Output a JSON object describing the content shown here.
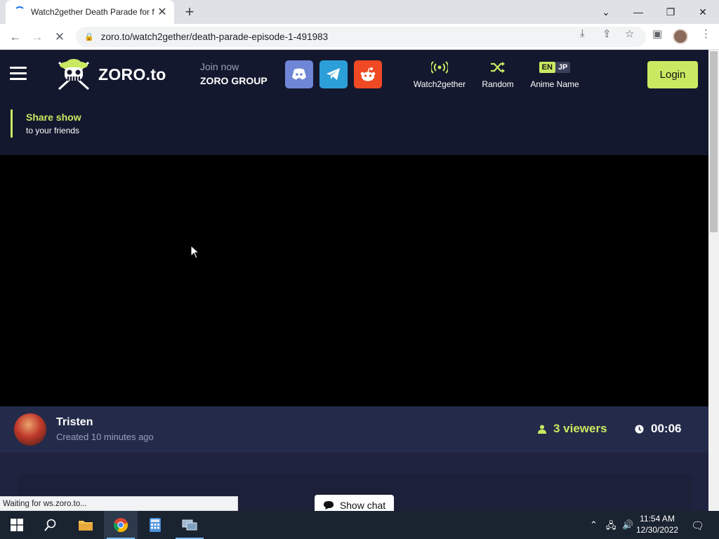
{
  "browser": {
    "tab_title": "Watch2gether Death Parade for f",
    "url": "zoro.to/watch2gether/death-parade-episode-1-491983",
    "status_text": "Waiting for ws.zoro.to..."
  },
  "site": {
    "logo_text": "ZORO.to",
    "join_top": "Join now",
    "join_bottom": "ZORO GROUP",
    "social": [
      "discord-icon",
      "telegram-icon",
      "reddit-icon"
    ],
    "nav": {
      "watch2gether": "Watch2gether",
      "random": "Random",
      "anime_name": "Anime Name",
      "lang_en": "EN",
      "lang_jp": "JP"
    },
    "login_label": "Login",
    "accent": "#cae962"
  },
  "share": {
    "title": "Share show",
    "subtitle": "to your friends"
  },
  "room": {
    "host_name": "Tristen",
    "created": "Created 10 minutes ago",
    "viewers": "3 viewers",
    "timer": "00:06"
  },
  "chat": {
    "show_chat_label": "Show chat"
  },
  "taskbar": {
    "time": "11:54 AM",
    "date": "12/30/2022"
  }
}
